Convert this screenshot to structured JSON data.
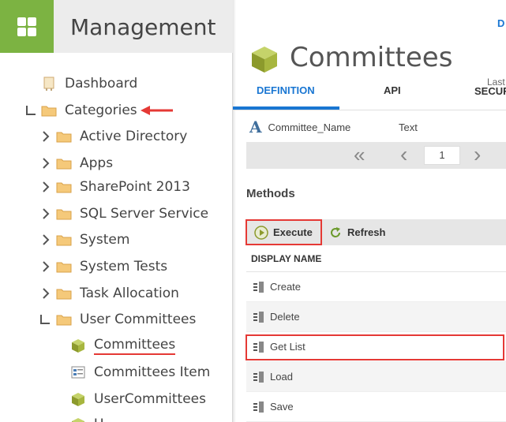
{
  "app": {
    "title": "Management"
  },
  "header": {
    "link": "D"
  },
  "tree": [
    {
      "label": "Dashboard",
      "icon": "dashboard-icon"
    },
    {
      "label": "Categories",
      "icon": "folder-icon",
      "expanded": true
    },
    {
      "label": "Active Directory",
      "icon": "folder-icon"
    },
    {
      "label": "Apps",
      "icon": "folder-icon"
    },
    {
      "label": "SharePoint 2013",
      "icon": "folder-icon"
    },
    {
      "label": "SQL Server Service",
      "icon": "folder-icon"
    },
    {
      "label": "System",
      "icon": "folder-icon"
    },
    {
      "label": "System Tests",
      "icon": "folder-icon"
    },
    {
      "label": "Task Allocation",
      "icon": "folder-icon"
    },
    {
      "label": "User Committees",
      "icon": "folder-icon",
      "expanded": true
    },
    {
      "label": "Committees",
      "icon": "smartobject-cube-icon",
      "selected": true
    },
    {
      "label": "Committees Item",
      "icon": "form-icon"
    },
    {
      "label": "UserCommittees",
      "icon": "smartobject-cube-icon"
    },
    {
      "label": "U",
      "icon": "smartobject-cube-icon"
    }
  ],
  "page": {
    "title": "Committees"
  },
  "tabs": {
    "definition": "DEFINITION",
    "api": "API",
    "last": "Last",
    "security": "SECUR"
  },
  "property": {
    "name": "Committee_Name",
    "type": "Text"
  },
  "pager": {
    "first": "«",
    "prev": "‹",
    "page": "1",
    "next": "›"
  },
  "methods": {
    "heading": "Methods",
    "execute": "Execute",
    "refresh": "Refresh",
    "column": "DISPLAY NAME",
    "rows": [
      "Create",
      "Delete",
      "Get List",
      "Load",
      "Save"
    ]
  },
  "colors": {
    "brand": "#7cb342",
    "accent": "#1976d2",
    "highlight": "#e53935"
  }
}
